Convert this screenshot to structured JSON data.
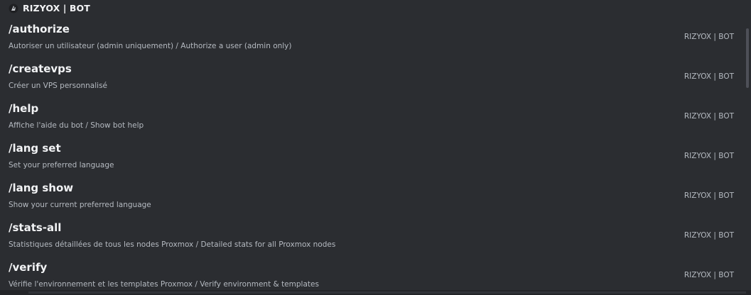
{
  "bot": {
    "name": "RIZYOX | BOT",
    "avatar_icon": "bot-avatar-icon"
  },
  "commands": [
    {
      "name": "/authorize",
      "description": "Autoriser un utilisateur (admin uniquement) / Authorize a user (admin only)",
      "source": "RIZYOX | BOT"
    },
    {
      "name": "/createvps",
      "description": "Créer un VPS personnalisé",
      "source": "RIZYOX | BOT"
    },
    {
      "name": "/help",
      "description": "Affiche l'aide du bot / Show bot help",
      "source": "RIZYOX | BOT"
    },
    {
      "name": "/lang set",
      "description": "Set your preferred language",
      "source": "RIZYOX | BOT"
    },
    {
      "name": "/lang show",
      "description": "Show your current preferred language",
      "source": "RIZYOX | BOT"
    },
    {
      "name": "/stats-all",
      "description": "Statistiques détaillées de tous les nodes Proxmox / Detailed stats for all Proxmox nodes",
      "source": "RIZYOX | BOT"
    },
    {
      "name": "/verify",
      "description": "Vérifie l'environnement et les templates Proxmox / Verify environment & templates",
      "source": "RIZYOX | BOT"
    }
  ],
  "colors": {
    "background": "#2b2d31",
    "heading_text": "#f2f3f5",
    "muted_text": "#b5bac1",
    "scroll_thumb": "#4e5058"
  }
}
